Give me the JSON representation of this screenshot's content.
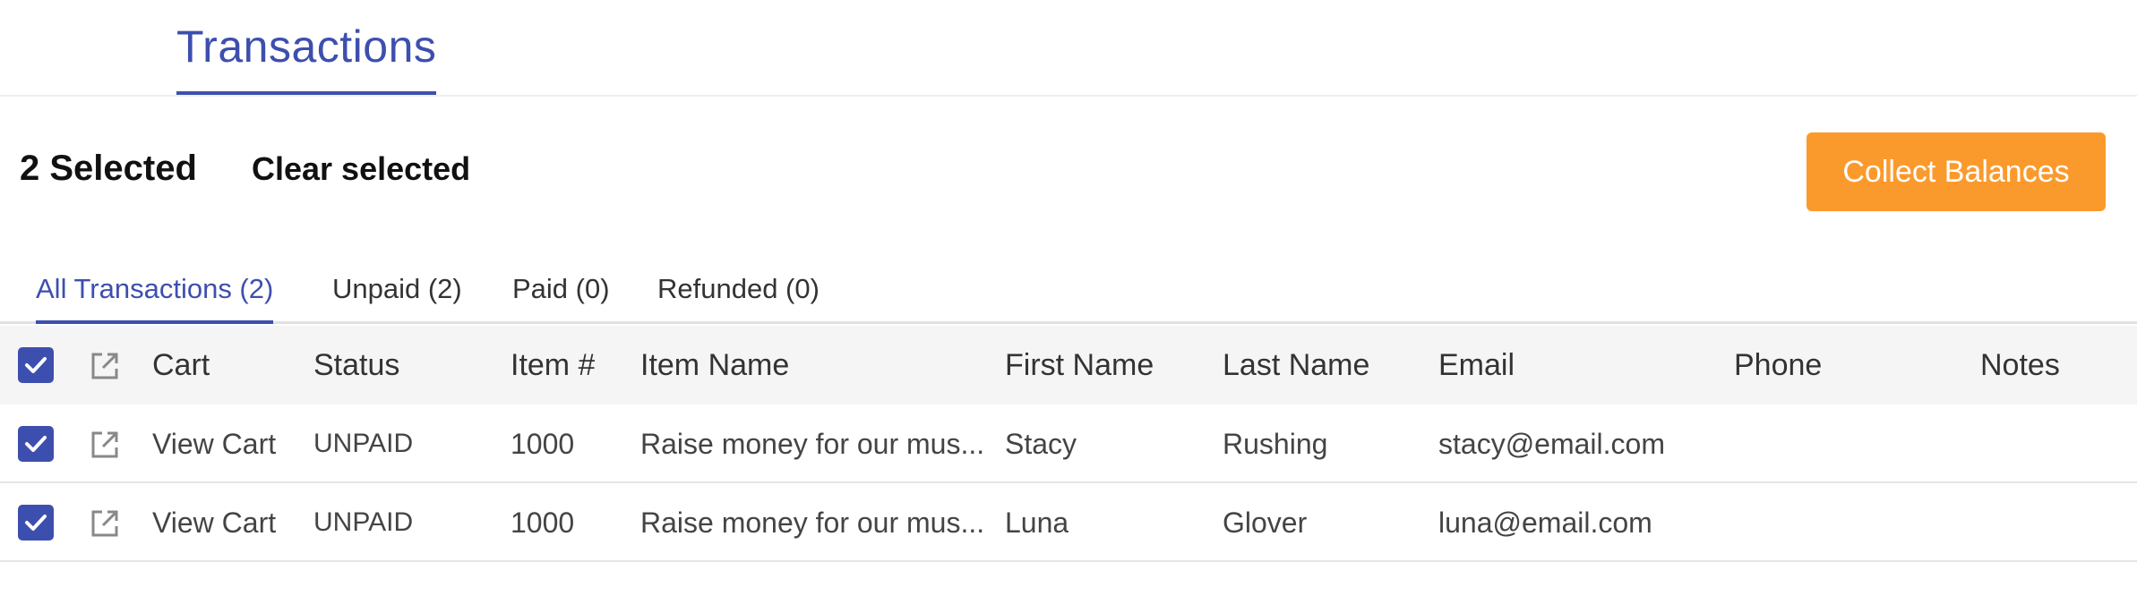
{
  "header": {
    "title": "Transactions"
  },
  "selection": {
    "count_label": "2 Selected",
    "clear_label": "Clear selected",
    "collect_label": "Collect Balances"
  },
  "filters": [
    {
      "label": "All Transactions (2)",
      "active": true
    },
    {
      "label": "Unpaid (2)",
      "active": false
    },
    {
      "label": "Paid (0)",
      "active": false
    },
    {
      "label": "Refunded (0)",
      "active": false
    }
  ],
  "table": {
    "columns": [
      "Cart",
      "Status",
      "Item #",
      "Item Name",
      "First Name",
      "Last Name",
      "Email",
      "Phone",
      "Notes"
    ],
    "rows": [
      {
        "checked": true,
        "cart": "View Cart",
        "status": "UNPAID",
        "item_number": "1000",
        "item_name": "Raise money for our mus...",
        "first_name": "Stacy",
        "last_name": "Rushing",
        "email": "stacy@email.com",
        "phone": "",
        "notes": ""
      },
      {
        "checked": true,
        "cart": "View Cart",
        "status": "UNPAID",
        "item_number": "1000",
        "item_name": "Raise money for our mus...",
        "first_name": "Luna",
        "last_name": "Glover",
        "email": "luna@email.com",
        "phone": "",
        "notes": ""
      }
    ]
  },
  "icons": {
    "checkbox": "checkbox-checked-icon",
    "open": "external-link-icon"
  },
  "colors": {
    "accent": "#3d4fae",
    "button": "#fb9a2c",
    "status_unpaid": "#e02626"
  }
}
